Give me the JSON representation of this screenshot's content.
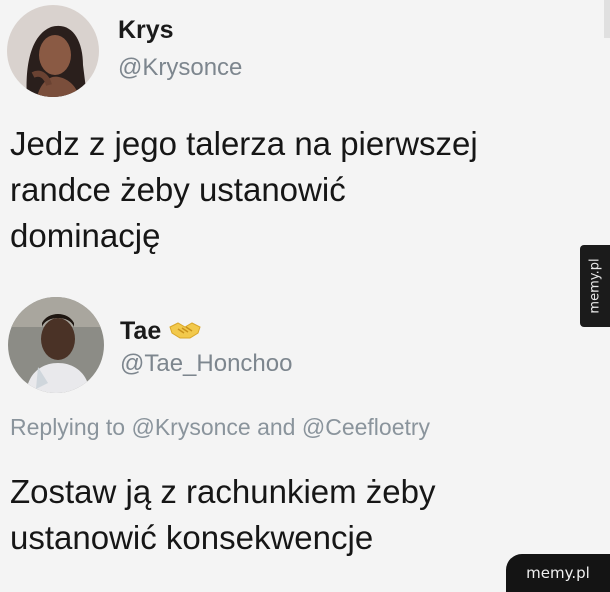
{
  "tweet1": {
    "name": "Krys",
    "handle": "@Krysonce",
    "text_lines": [
      "Jedz z jego talerza na pierwszej",
      "randce żeby ustanowić",
      "dominację"
    ]
  },
  "tweet2": {
    "name": "Tae",
    "name_emoji": "handshake-emoji",
    "handle": "@Tae_Honchoo",
    "reply": {
      "prefix": "Replying to",
      "mention1": "@Krysonce",
      "conjunction": "and",
      "mention2": "@Ceefloetry"
    },
    "text_lines": [
      "Zostaw ją z rachunkiem żeby",
      "ustanowić konsekwencje"
    ]
  },
  "watermarks": {
    "side": "memy.pl",
    "corner": "memy.pl"
  },
  "colors": {
    "background": "#f4f4f4",
    "handle_gray": "#7d868e",
    "watermark_bg": "#141414"
  }
}
